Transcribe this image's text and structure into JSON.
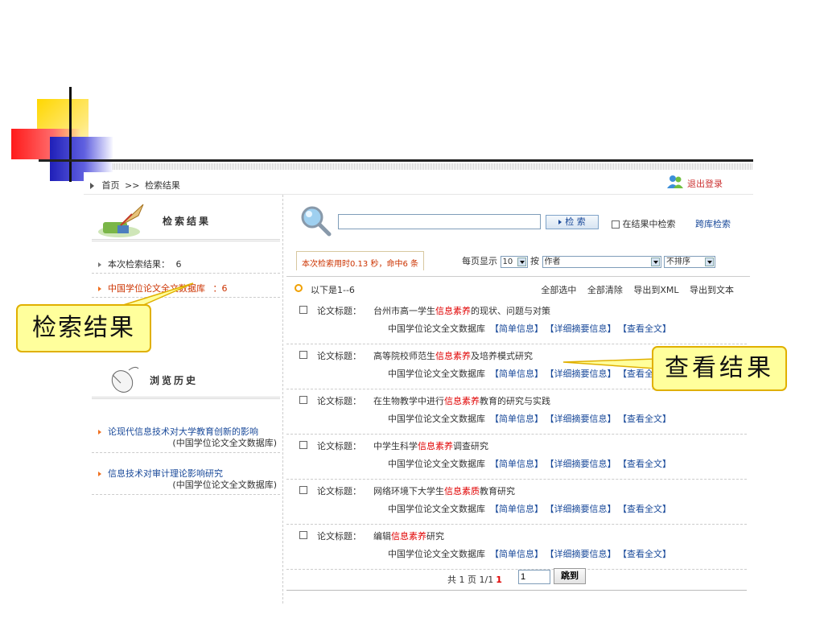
{
  "topbar": {
    "home": "首页",
    "separator": ">>",
    "current": "检索结果",
    "logout": "退出登录"
  },
  "sidebar": {
    "result_title": "检索结果",
    "items": [
      {
        "label": "本次检索结果：",
        "value": "6"
      },
      {
        "label": "中国学位论文全文数据库",
        "value": "：6"
      }
    ],
    "history_title": "浏览历史",
    "history": [
      {
        "title": "论现代信息技术对大学教育创新的影响",
        "source": "(中国学位论文全文数据库)"
      },
      {
        "title": "信息技术对审计理论影响研究",
        "source": "(中国学位论文全文数据库)"
      }
    ]
  },
  "search": {
    "input_value": "",
    "button": "检 索",
    "in_result": "在结果中检索",
    "cross": "跨库检索"
  },
  "toolbar": {
    "timing": "本次检索用时0.13 秒，命中6 条",
    "per_page_label": "每页显示",
    "per_page_value": "10",
    "by_label": "按",
    "sort_field": "作者",
    "sort_order": "不排序"
  },
  "list": {
    "range": "以下是1--6",
    "actions": [
      "全部选中",
      "全部清除",
      "导出到XML",
      "导出到文本"
    ],
    "label": "论文标题：",
    "db": "中国学位论文全文数据库",
    "links": [
      "【简单信息】",
      "【详细摘要信息】",
      "【查看全文】"
    ],
    "results": [
      {
        "pre": "台州市高一学生",
        "hl": "信息素养",
        "post": "的现状、问题与对策"
      },
      {
        "pre": "高等院校师范生",
        "hl": "信息素养",
        "post": "及培养模式研究"
      },
      {
        "pre": "在生物教学中进行",
        "hl": "信息素养",
        "post": "教育的研究与实践"
      },
      {
        "pre": "中学生科学",
        "hl": "信息素养",
        "post": "调查研究"
      },
      {
        "pre": "网络环境下大学生",
        "hl": "信息素质",
        "post": "教育研究"
      },
      {
        "pre": "编辑",
        "hl": "信息素养",
        "post": "研究"
      }
    ]
  },
  "pager": {
    "text": "共 1 页 1/1",
    "current": "1",
    "input_value": "1",
    "jump": "跳到"
  },
  "callouts": {
    "left": "检索结果",
    "right": "查看结果"
  },
  "colors": {
    "highlight": "#e00000",
    "link": "#1a4a9a",
    "callout_bg": "#ffff9c"
  }
}
